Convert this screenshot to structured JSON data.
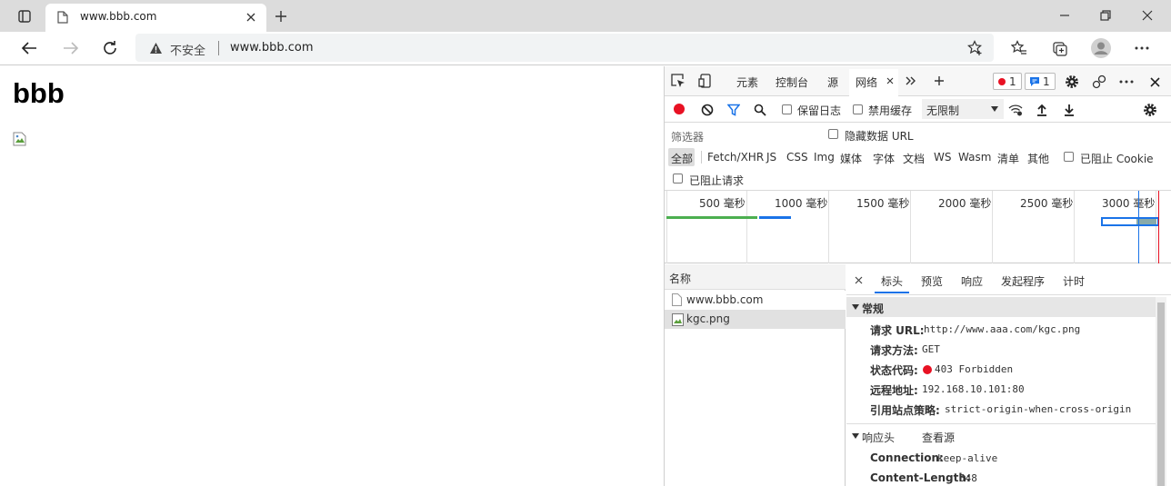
{
  "browser": {
    "tab_title": "www.bbb.com",
    "security_label": "不安全",
    "url": "www.bbb.com"
  },
  "page": {
    "heading": "bbb"
  },
  "devtools": {
    "tabs": [
      "元素",
      "控制台",
      "源",
      "网络"
    ],
    "error_count": "1",
    "message_count": "1",
    "network_toolbar": {
      "preserve_log": "保留日志",
      "disable_cache": "禁用缓存",
      "throttle": "无限制"
    },
    "filter": {
      "placeholder": "筛选器",
      "hide_data_url": "隐藏数据 URL",
      "types": [
        "全部",
        "Fetch/XHR",
        "JS",
        "CSS",
        "Img",
        "媒体",
        "字体",
        "文档",
        "WS",
        "Wasm",
        "清单",
        "其他"
      ],
      "blocked_cookies": "已阻止 Cookie",
      "blocked_requests": "已阻止请求"
    },
    "timeline_ticks": [
      "500 毫秒",
      "1000 毫秒",
      "1500 毫秒",
      "2000 毫秒",
      "2500 毫秒",
      "3000 毫秒"
    ],
    "requests_header": "名称",
    "requests": [
      "www.bbb.com",
      "kgc.png"
    ],
    "detail_tabs": [
      "标头",
      "预览",
      "响应",
      "发起程序",
      "计时"
    ],
    "general": {
      "title": "常规",
      "rows": [
        {
          "k": "请求 URL:",
          "v": "http://www.aaa.com/kgc.png"
        },
        {
          "k": "请求方法:",
          "v": "GET"
        },
        {
          "k": "状态代码:",
          "v": "403 Forbidden"
        },
        {
          "k": "远程地址:",
          "v": "192.168.10.101:80"
        },
        {
          "k": "引用站点策略:",
          "v": "strict-origin-when-cross-origin"
        }
      ]
    },
    "response_headers": {
      "title": "响应头",
      "view_source": "查看源",
      "rows": [
        {
          "k": "Connection:",
          "v": "keep-alive"
        },
        {
          "k": "Content-Length:",
          "v": "548"
        }
      ]
    },
    "colors": {
      "error": "#e81123",
      "accent": "#1a73e8",
      "record": "#e81123"
    }
  }
}
